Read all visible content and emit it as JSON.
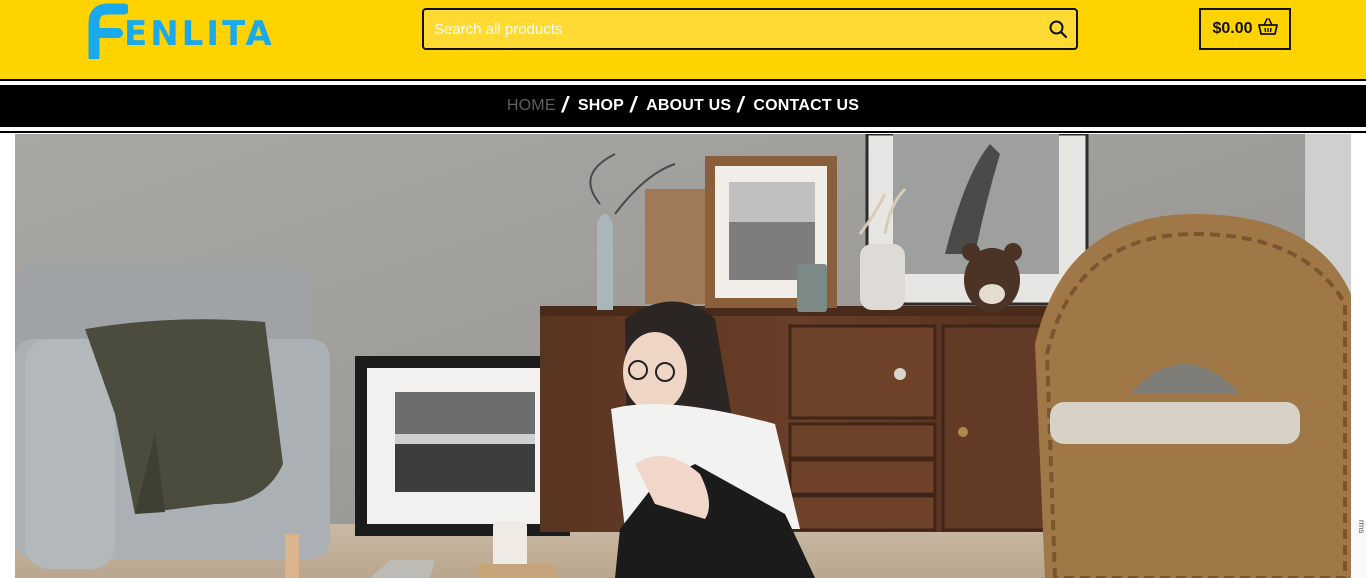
{
  "brand": {
    "name": "ENLITA",
    "accent": "#1aa9ea"
  },
  "colors": {
    "header_bg": "#ffd300",
    "nav_bg": "#000000"
  },
  "search": {
    "placeholder": "Search all products",
    "icon": "search-icon"
  },
  "cart": {
    "total": "$0.00",
    "icon": "basket-icon"
  },
  "nav": {
    "items": [
      {
        "label": "HOME",
        "active": true
      },
      {
        "label": "SHOP"
      },
      {
        "label": "ABOUT US"
      },
      {
        "label": "CONTACT US"
      }
    ],
    "separator": "/"
  },
  "recaptcha": {
    "text": "rms"
  }
}
